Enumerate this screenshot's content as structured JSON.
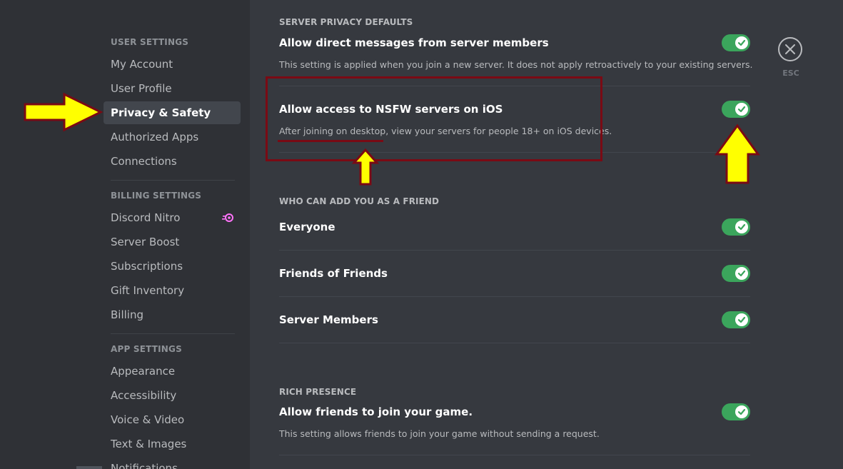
{
  "sidebar": {
    "user_settings_header": "USER SETTINGS",
    "user_items": [
      "My Account",
      "User Profile",
      "Privacy & Safety",
      "Authorized Apps",
      "Connections"
    ],
    "billing_header": "BILLING SETTINGS",
    "billing_items": [
      "Discord Nitro",
      "Server Boost",
      "Subscriptions",
      "Gift Inventory",
      "Billing"
    ],
    "app_header": "APP SETTINGS",
    "app_items": [
      "Appearance",
      "Accessibility",
      "Voice & Video",
      "Text & Images",
      "Notifications"
    ],
    "selected_item": "Privacy & Safety"
  },
  "content": {
    "privacy_header": "SERVER PRIVACY DEFAULTS",
    "dm_title": "Allow direct messages from server members",
    "dm_desc": "This setting is applied when you join a new server. It does not apply retroactively to your existing servers.",
    "dm_enabled": true,
    "nsfw_title": "Allow access to NSFW servers on iOS",
    "nsfw_desc": "After joining on desktop, view your servers for people 18+ on iOS devices.",
    "nsfw_enabled": true,
    "friend_header": "WHO CAN ADD YOU AS A FRIEND",
    "everyone_label": "Everyone",
    "everyone_enabled": true,
    "fof_label": "Friends of Friends",
    "fof_enabled": true,
    "server_members_label": "Server Members",
    "server_members_enabled": true,
    "rich_header": "RICH PRESENCE",
    "join_title": "Allow friends to join your game.",
    "join_desc": "This setting allows friends to join your game without sending a request.",
    "join_enabled": true
  },
  "close": {
    "label": "ESC"
  },
  "colors": {
    "toggle_on": "#3ba55c",
    "sidebar_bg": "#2f3136",
    "content_bg": "#36393f",
    "annotation_arrow": "#ffff00",
    "annotation_outline": "#7a0a14",
    "nitro_pink": "#ff73fa"
  }
}
